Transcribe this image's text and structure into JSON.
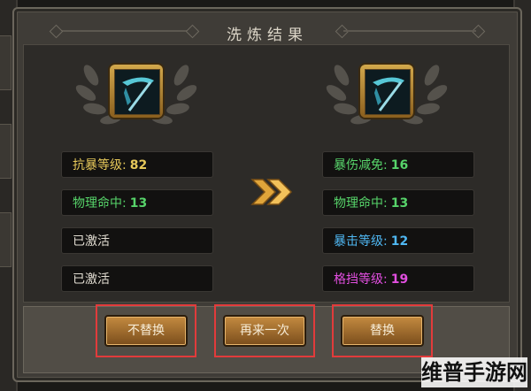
{
  "title": "洗炼结果",
  "left_item": {
    "icon": "weapon-scythe-icon",
    "stats": [
      {
        "label": "抗暴等级:",
        "value": "82",
        "color": "#e6c85a"
      },
      {
        "label": "物理命中:",
        "value": "13",
        "color": "#57d46a"
      },
      {
        "label": "已激活",
        "value": "",
        "color": "#e2ddd2"
      },
      {
        "label": "已激活",
        "value": "",
        "color": "#e2ddd2"
      }
    ]
  },
  "right_item": {
    "icon": "weapon-scythe-icon",
    "stats": [
      {
        "label": "暴伤减免:",
        "value": "16",
        "color": "#57d46a"
      },
      {
        "label": "物理命中:",
        "value": "13",
        "color": "#57d46a"
      },
      {
        "label": "暴击等级:",
        "value": "12",
        "color": "#4fb7f2"
      },
      {
        "label": "格挡等级:",
        "value": "19",
        "color": "#e24fe0"
      }
    ]
  },
  "buttons": {
    "keep": "不替换",
    "again": "再来一次",
    "replace": "替换"
  },
  "watermark": "维普手游网"
}
